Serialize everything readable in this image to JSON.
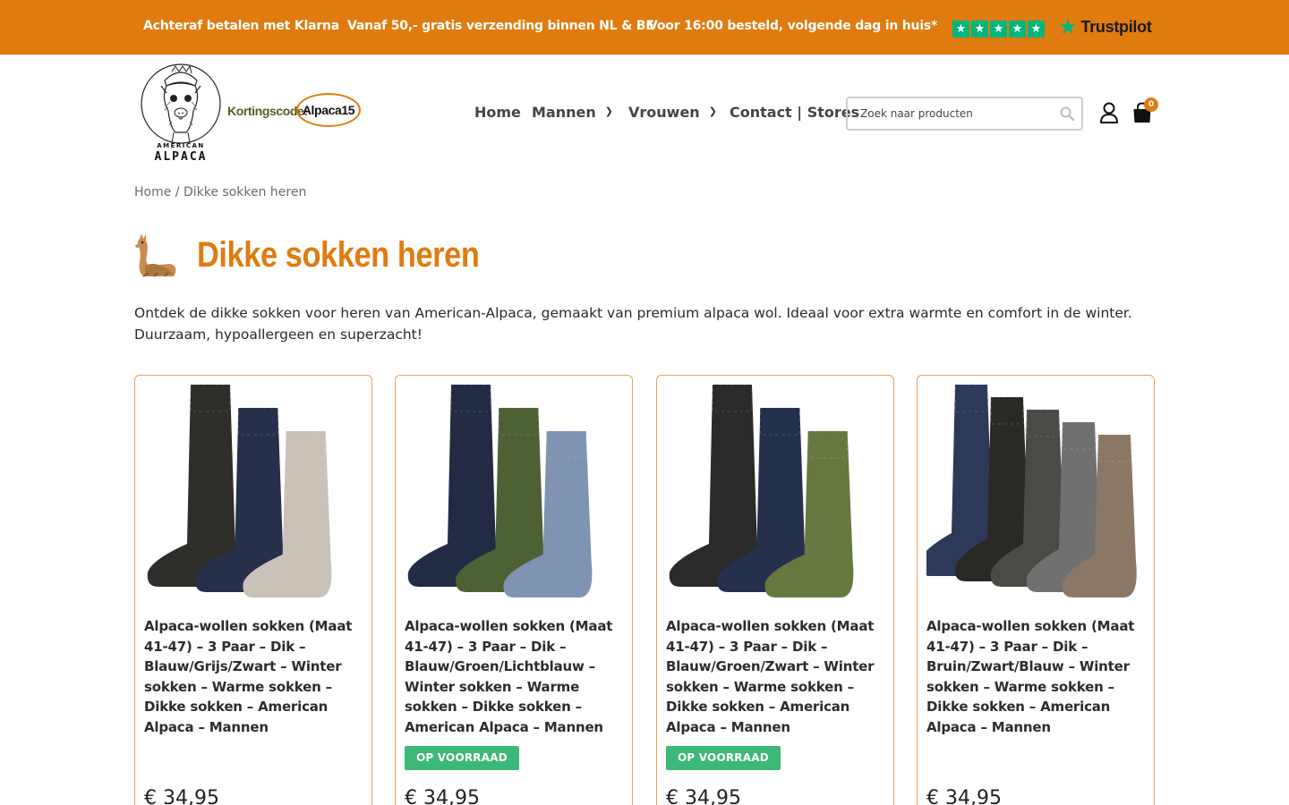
{
  "topbar": {
    "usps": [
      "Achteraf betalen met Klarna",
      "Vanaf 50,- gratis verzending binnen NL & BE",
      "Voor 16:00 besteld, volgende dag in huis*"
    ],
    "trustpilot_label": "Trustpilot",
    "rating_stars": 5
  },
  "header": {
    "logo_sub": "AMERICAN",
    "logo_name": "ALPACA",
    "coupon_label": "Kortingscode:",
    "coupon_code": "Alpaca15",
    "nav": {
      "home": "Home",
      "men": "Mannen",
      "women": "Vrouwen",
      "contact": "Contact | Stores"
    },
    "search_placeholder": "Zoek naar producten",
    "cart_count": "0"
  },
  "breadcrumb": "Home / Dikke sokken heren",
  "page_title": "Dikke sokken heren",
  "intro": "Ontdek de dikke sokken voor heren van American-Alpaca, gemaakt van premium alpaca wol. Ideaal voor extra warmte en comfort in de winter. Duurzaam, hypoallergeen en superzacht!",
  "products": [
    {
      "name": "Alpaca-wollen sokken (Maat 41-47) – 3 Paar – Dik – Blauw/Grijs/Zwart – Winter sokken – Warme sokken – Dikke sokken – American Alpaca – Mannen",
      "stock": "",
      "price": "€ 34,95",
      "sock_colors": [
        "#2e2d2a",
        "#27304a",
        "#c9c2b8"
      ]
    },
    {
      "name": "Alpaca-wollen sokken (Maat 41-47) – 3 Paar – Dik – Blauw/Groen/Lichtblauw – Winter sokken – Warme sokken – Dikke sokken – American Alpaca – Mannen",
      "stock": "OP VOORRAAD",
      "price": "€ 34,95",
      "sock_colors": [
        "#232b44",
        "#4e6135",
        "#7f93b3"
      ]
    },
    {
      "name": "Alpaca-wollen sokken (Maat 41-47) – 3 Paar – Dik – Blauw/Groen/Zwart – Winter sokken – Warme sokken – Dikke sokken – American Alpaca – Mannen",
      "stock": "OP VOORRAAD",
      "price": "€ 34,95",
      "sock_colors": [
        "#2a2a28",
        "#25304d",
        "#66783f"
      ]
    },
    {
      "name": "Alpaca-wollen sokken (Maat 41-47) – 3 Paar – Dik – Bruin/Zwart/Blauw – Winter sokken – Warme sokken – Dikke sokken – American Alpaca – Mannen",
      "stock": "",
      "price": "€ 34,95",
      "sock_colors": [
        "#2d3958",
        "#2a2926",
        "#4b4a47",
        "#707070",
        "#8a7766"
      ]
    }
  ],
  "colors": {
    "accent": "#e07b0f",
    "stock_badge": "#3cb878",
    "trustpilot": "#00b67a"
  }
}
